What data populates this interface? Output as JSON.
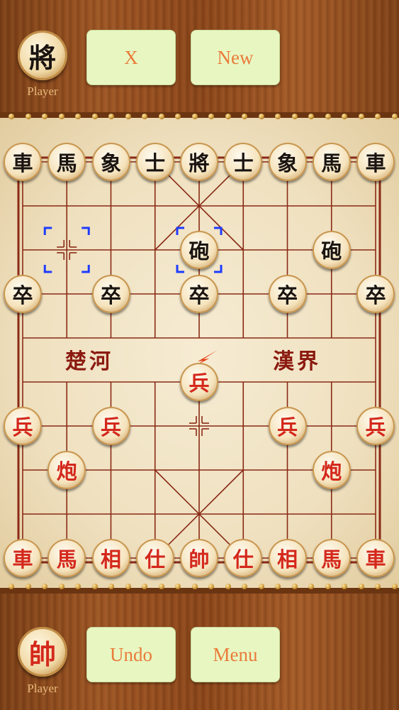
{
  "top": {
    "avatar_char": "將",
    "player_label": "Player",
    "button_x_label": "X",
    "button_new_label": "New"
  },
  "bottom": {
    "avatar_char": "帥",
    "player_label": "Player",
    "button_undo_label": "Undo",
    "button_menu_label": "Menu"
  },
  "board": {
    "river_left": "楚河",
    "river_right": "漢界",
    "colors": {
      "red": "#d4281c",
      "black": "#1a1410",
      "selection": "#1e3cff",
      "last_move": "#e63b14"
    },
    "pieces": [
      {
        "char": "車",
        "side": "black",
        "col": 0,
        "row": 0
      },
      {
        "char": "馬",
        "side": "black",
        "col": 1,
        "row": 0
      },
      {
        "char": "象",
        "side": "black",
        "col": 2,
        "row": 0
      },
      {
        "char": "士",
        "side": "black",
        "col": 3,
        "row": 0
      },
      {
        "char": "將",
        "side": "black",
        "col": 4,
        "row": 0
      },
      {
        "char": "士",
        "side": "black",
        "col": 5,
        "row": 0
      },
      {
        "char": "象",
        "side": "black",
        "col": 6,
        "row": 0
      },
      {
        "char": "馬",
        "side": "black",
        "col": 7,
        "row": 0
      },
      {
        "char": "車",
        "side": "black",
        "col": 8,
        "row": 0
      },
      {
        "char": "砲",
        "side": "black",
        "col": 4,
        "row": 2
      },
      {
        "char": "砲",
        "side": "black",
        "col": 7,
        "row": 2
      },
      {
        "char": "卒",
        "side": "black",
        "col": 0,
        "row": 3
      },
      {
        "char": "卒",
        "side": "black",
        "col": 2,
        "row": 3
      },
      {
        "char": "卒",
        "side": "black",
        "col": 4,
        "row": 3
      },
      {
        "char": "卒",
        "side": "black",
        "col": 6,
        "row": 3
      },
      {
        "char": "卒",
        "side": "black",
        "col": 8,
        "row": 3
      },
      {
        "char": "兵",
        "side": "red",
        "col": 4,
        "row": 5
      },
      {
        "char": "兵",
        "side": "red",
        "col": 0,
        "row": 6
      },
      {
        "char": "兵",
        "side": "red",
        "col": 2,
        "row": 6
      },
      {
        "char": "兵",
        "side": "red",
        "col": 6,
        "row": 6
      },
      {
        "char": "兵",
        "side": "red",
        "col": 8,
        "row": 6
      },
      {
        "char": "炮",
        "side": "red",
        "col": 1,
        "row": 7
      },
      {
        "char": "炮",
        "side": "red",
        "col": 7,
        "row": 7
      },
      {
        "char": "車",
        "side": "red",
        "col": 0,
        "row": 9
      },
      {
        "char": "馬",
        "side": "red",
        "col": 1,
        "row": 9
      },
      {
        "char": "相",
        "side": "red",
        "col": 2,
        "row": 9
      },
      {
        "char": "仕",
        "side": "red",
        "col": 3,
        "row": 9
      },
      {
        "char": "帥",
        "side": "red",
        "col": 4,
        "row": 9
      },
      {
        "char": "仕",
        "side": "red",
        "col": 5,
        "row": 9
      },
      {
        "char": "相",
        "side": "red",
        "col": 6,
        "row": 9
      },
      {
        "char": "馬",
        "side": "red",
        "col": 7,
        "row": 9
      },
      {
        "char": "車",
        "side": "red",
        "col": 8,
        "row": 9
      }
    ],
    "selection_markers": [
      {
        "col": 1,
        "row": 2
      },
      {
        "col": 4,
        "row": 2
      }
    ],
    "last_move_marker": {
      "col": 4,
      "row": 4.5
    }
  }
}
